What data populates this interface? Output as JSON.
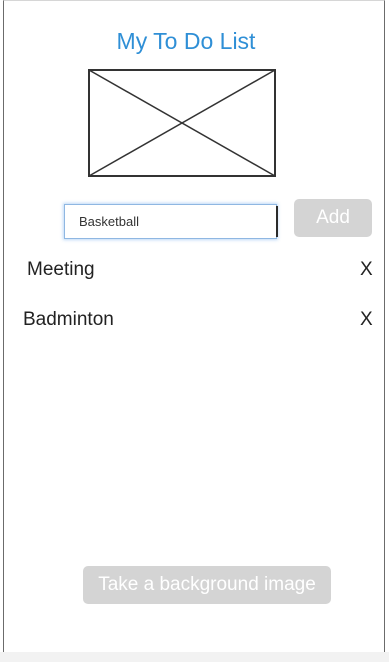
{
  "header": {
    "title": "My To Do List"
  },
  "image_placeholder": {
    "icon": "image-placeholder-icon"
  },
  "new_task": {
    "value": "Basketball",
    "placeholder": ""
  },
  "add_button": {
    "label": "Add"
  },
  "todos": [
    {
      "text": "Meeting",
      "delete_label": "X"
    },
    {
      "text": "Badminton",
      "delete_label": "X"
    }
  ],
  "background_button": {
    "label": "Take a background image"
  },
  "colors": {
    "title": "#2f8fd6",
    "button_bg": "#d4d4d4",
    "button_text": "#ffffff",
    "input_focus_border": "#8fb7e2"
  }
}
